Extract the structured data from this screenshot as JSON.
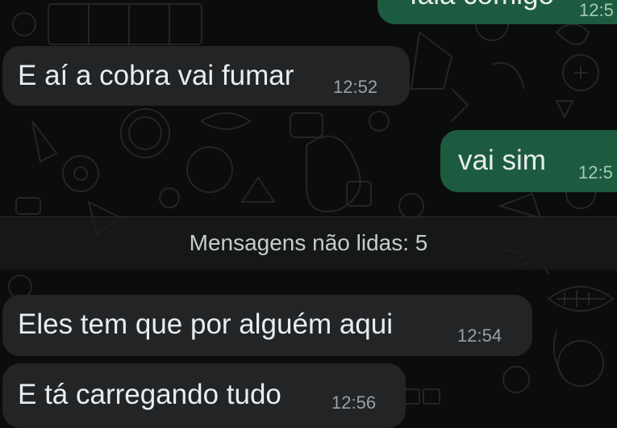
{
  "chat": {
    "messages": [
      {
        "direction": "outgoing",
        "text": "fala comigo",
        "time": "12:5"
      },
      {
        "direction": "incoming",
        "text": "E aí a cobra vai fumar",
        "time": "12:52"
      },
      {
        "direction": "outgoing",
        "text": "vai sim",
        "time": "12:5"
      },
      {
        "direction": "incoming",
        "text": "Eles tem que por alguém aqui",
        "time": "12:54"
      },
      {
        "direction": "incoming",
        "text": "E tá carregando tudo",
        "time": "12:56"
      }
    ],
    "unread_divider": "Mensagens não lidas: 5"
  },
  "colors": {
    "background": "#0b0c0c",
    "incoming_bubble": "#222426",
    "outgoing_bubble": "#1c5b3f",
    "text": "#e9edef",
    "timestamp": "#9aa0a3"
  }
}
